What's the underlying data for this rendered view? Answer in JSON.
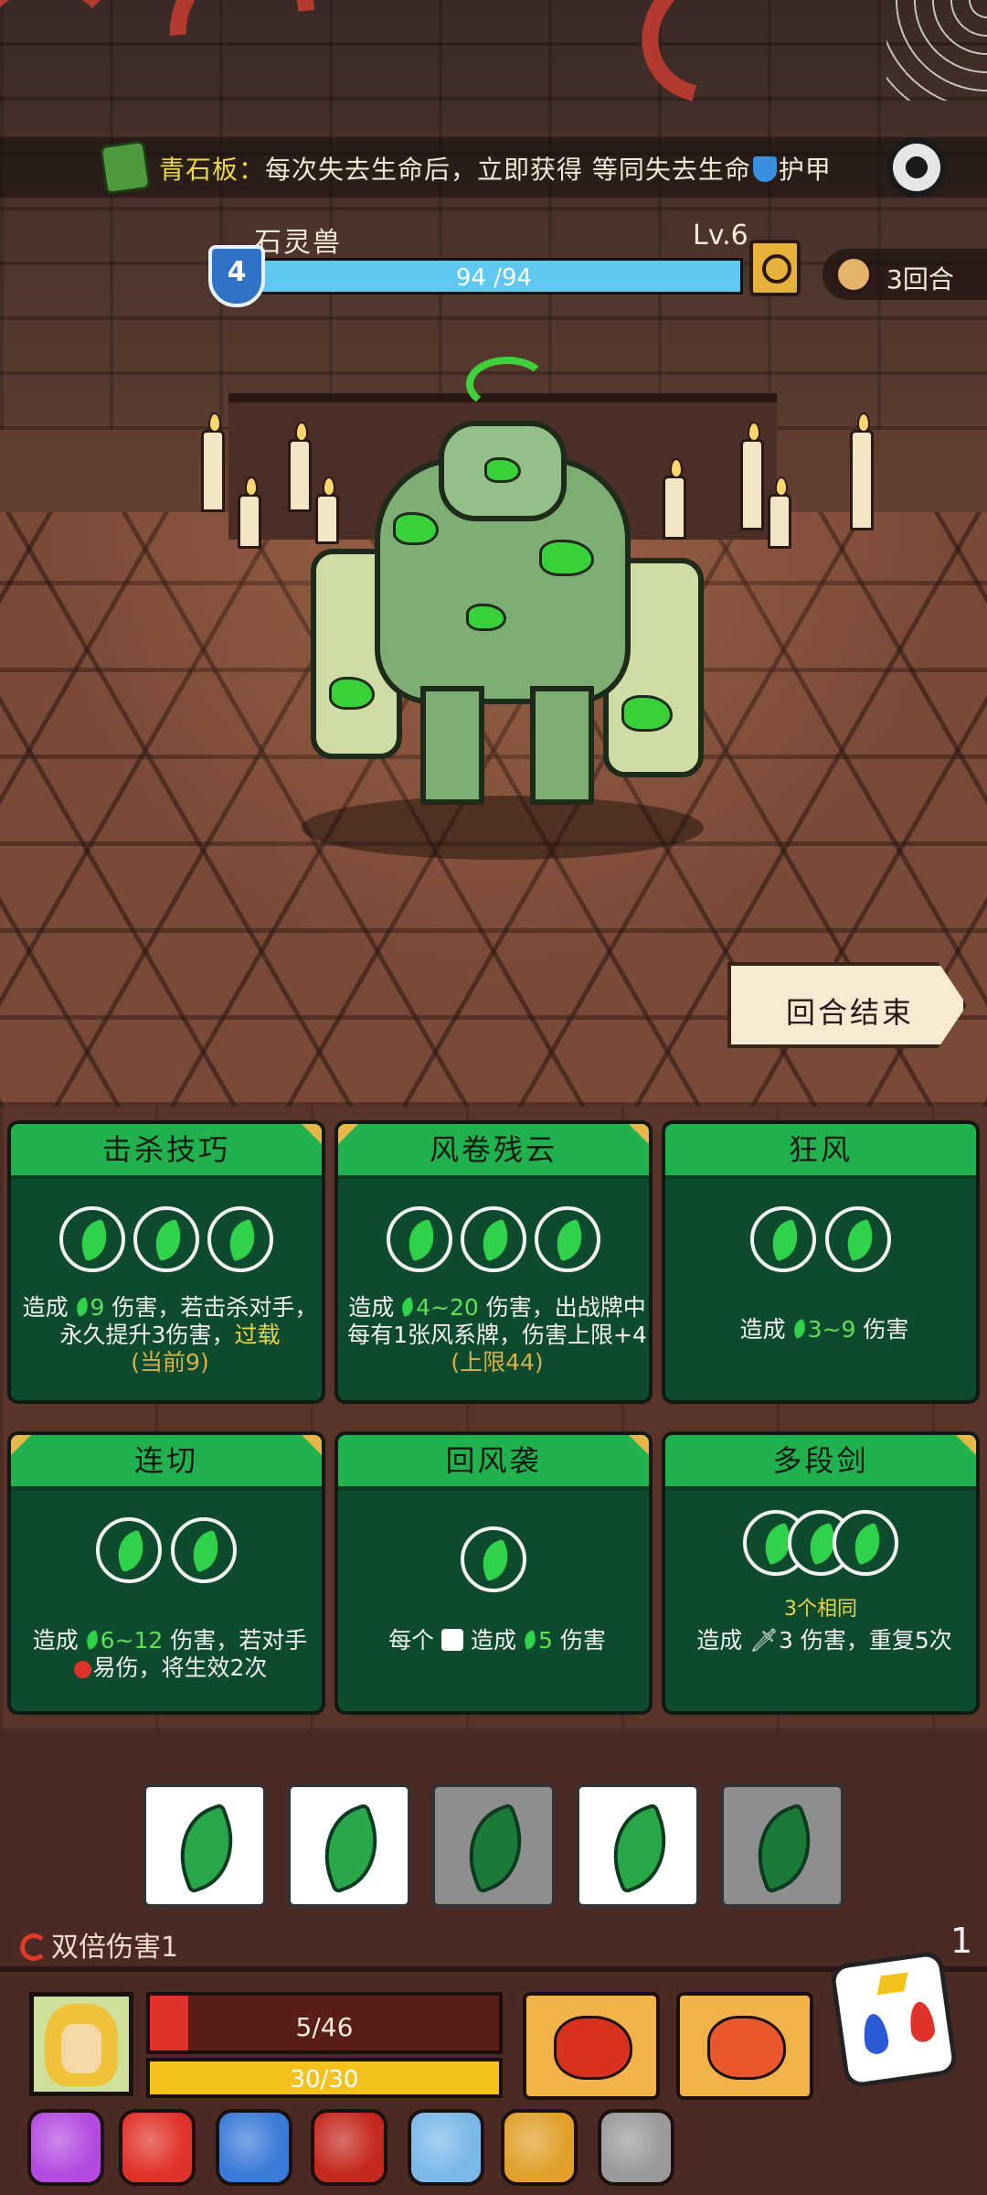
{
  "relic": {
    "name": "青石板：",
    "text_before": "每次失去生命后，立即获得 等同失去生命",
    "text_after": "护甲",
    "icon": "green-stone-tablet-icon"
  },
  "settings": {
    "icon": "gear-spider-icon"
  },
  "enemy": {
    "name": "石灵兽",
    "level": "Lv.6",
    "hp_current": 94,
    "hp_max": 94,
    "hp_text": "94 /94",
    "armor": "4",
    "intent_icon": "magnifier-intent-icon"
  },
  "turn": {
    "text": "3回合",
    "icon": "scroll-turn-icon"
  },
  "end_turn": {
    "label": "回合结束"
  },
  "cards": [
    {
      "title": "击杀技巧",
      "slots": 3,
      "desc_a": "造成",
      "desc_value": "9",
      "desc_b": " 伤害，若击杀对手，永久提升3伤害，",
      "desc_keyword": "过载",
      "desc_note": "(当前9)"
    },
    {
      "title": "风卷残云",
      "slots": 3,
      "desc_a": "造成",
      "desc_value": "4~20",
      "desc_b": " 伤害，出战牌中每有1张风系牌，伤害上限+4 ",
      "desc_note": "(上限44)"
    },
    {
      "title": "狂风",
      "slots": 2,
      "desc_a": "造成",
      "desc_value": "3~9",
      "desc_b": " 伤害"
    },
    {
      "title": "连切",
      "slots": 2,
      "desc_a": "造成",
      "desc_value": "6~12",
      "desc_b": " 伤害，若对手",
      "desc_c": "易伤，将生效2次"
    },
    {
      "title": "回风袭",
      "slots": 1,
      "desc_a": "每个",
      "desc_b": " 造成",
      "desc_value": "5",
      "desc_c": " 伤害"
    },
    {
      "title": "多段剑",
      "slots": 3,
      "same_label": "3个相同",
      "desc_a": "造成",
      "desc_b": "3 伤害，重复5次"
    }
  ],
  "dice": [
    {
      "face": "wind-leaf",
      "state": "active"
    },
    {
      "face": "wind-leaf",
      "state": "active"
    },
    {
      "face": "wind-leaf",
      "state": "used"
    },
    {
      "face": "wind-leaf",
      "state": "active"
    },
    {
      "face": "wind-leaf",
      "state": "used"
    }
  ],
  "status": {
    "label": "双倍伤害1",
    "icon": "double-damage-swirl-icon"
  },
  "corner_number": "1",
  "player": {
    "hp_current": 5,
    "hp_max": 46,
    "hp_text": "5/46",
    "energy_current": 30,
    "energy_max": 30,
    "energy_text": "30/30",
    "portrait_icon": "hero-portrait-icon",
    "skills": [
      "fist-skill-icon",
      "fire-blast-skill-icon"
    ],
    "dice_icon": "elemental-dice-icon"
  },
  "items": [
    {
      "icon": "purple-potion-icon",
      "color": "#b44ae0"
    },
    {
      "icon": "fire-dagger-icon",
      "color": "#e0322a"
    },
    {
      "icon": "blue-crystal-icon",
      "color": "#3a7ad8"
    },
    {
      "icon": "red-demon-mask-icon",
      "color": "#c4281e"
    },
    {
      "icon": "ice-claw-icon",
      "color": "#7ab8e8"
    },
    {
      "icon": "golden-pot-icon",
      "color": "#e0a02a"
    },
    {
      "icon": "silver-feather-icon",
      "color": "#9a9a9a"
    }
  ],
  "colors": {
    "card_header": "#21b14f",
    "card_body": "#0e4a2e",
    "enemy_hp": "#5ec8f0",
    "player_hp": "#e0322a",
    "energy": "#f5c21d",
    "keyword_yellow": "#e6d54a"
  }
}
